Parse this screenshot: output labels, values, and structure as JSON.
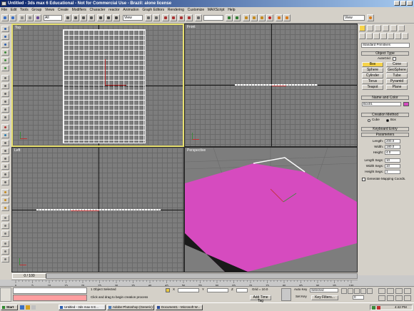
{
  "window": {
    "title": "Untitled - 3ds max 6 Educational - Not for Commercial Use - Brazil: alone license"
  },
  "menu": [
    "File",
    "Edit",
    "Tools",
    "Group",
    "Views",
    "Create",
    "Modifiers",
    "Character",
    "reactor",
    "Animation",
    "Graph Editors",
    "Rendering",
    "Customize",
    "MAXScript",
    "Help"
  ],
  "toolbar": {
    "selection_filter": "All",
    "ref_coord": "View",
    "named_set": "",
    "view_select": "View"
  },
  "viewports": {
    "top": "Top",
    "front": "Front",
    "left": "Left",
    "perspective": "Perspective"
  },
  "colors": {
    "viewport_bg": "#7d7d7d",
    "active_border": "#e8e070",
    "box_color": "#d64bbf",
    "highlight": "#f6d34a"
  },
  "command_panel": {
    "dropdown": "Standard Primitives",
    "object_type": {
      "header": "Object Type",
      "autogrid": "AutoGrid",
      "buttons": [
        "Box",
        "Cone",
        "Sphere",
        "GeoSphere",
        "Cylinder",
        "Tube",
        "Torus",
        "Pyramid",
        "Teapot",
        "Plane"
      ],
      "active": "Box"
    },
    "name_color": {
      "header": "Name and Color",
      "name": "Box01"
    },
    "creation_method": {
      "header": "Creation Method",
      "cube": "Cube",
      "box": "Box",
      "selected": "Box"
    },
    "keyboard_entry": {
      "header": "Keyboard Entry"
    },
    "parameters": {
      "header": "Parameters",
      "fields": [
        {
          "label": "Length:",
          "value": "200.0"
        },
        {
          "label": "Width:",
          "value": "180.0"
        },
        {
          "label": "Height:",
          "value": "4.0"
        },
        {
          "label": "Length Segs:",
          "value": "10"
        },
        {
          "label": "Width Segs:",
          "value": "10"
        },
        {
          "label": "Height Segs:",
          "value": "1"
        }
      ],
      "gen_mapping": "Generate Mapping Coords."
    }
  },
  "timeline": {
    "frame_label": "0 / 100",
    "ticks": [
      "0",
      "5",
      "10",
      "15",
      "20",
      "25",
      "30",
      "35",
      "40",
      "45",
      "50",
      "55",
      "60",
      "65",
      "70",
      "75",
      "80",
      "85",
      "90",
      "95",
      "100"
    ]
  },
  "status": {
    "selected": "1 Object Selected",
    "prompt": "Click and drag to begin creation process",
    "x_label": "X",
    "y_label": "Y",
    "z_label": "Z",
    "grid": "Grid = 10.0",
    "add_time_tag": "Add Time Tag",
    "auto_key": "Auto Key",
    "set_key": "Set Key",
    "key_mode": "Selected",
    "key_filters": "Key Filters...",
    "frame": "0"
  },
  "taskbar": {
    "start": "Start",
    "tasks": [
      "Untitled - 3ds max 6 E...",
      "Adobe Photoshop (Generic)",
      "Document1 - Microsoft W..."
    ],
    "clock": "4:42 PM"
  }
}
